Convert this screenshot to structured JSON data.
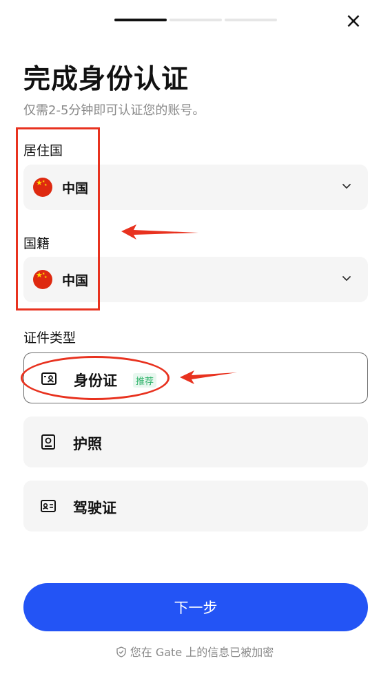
{
  "header": {
    "progress": {
      "steps_total": 3,
      "current_step": 1
    },
    "close_glyph": "×"
  },
  "title": "完成身份认证",
  "subtitle": "仅需2-5分钟即可认证您的账号。",
  "residence": {
    "label": "居住国",
    "value": "中国",
    "flag": "china-flag"
  },
  "nationality": {
    "label": "国籍",
    "value": "中国",
    "flag": "china-flag"
  },
  "document_type": {
    "label": "证件类型",
    "options": [
      {
        "label": "身份证",
        "badge": "推荐",
        "icon": "id-card-icon",
        "selected": true
      },
      {
        "label": "护照",
        "icon": "passport-icon",
        "selected": false
      },
      {
        "label": "驾驶证",
        "icon": "drivers-license-icon",
        "selected": false
      }
    ]
  },
  "next_button": "下一步",
  "footer": "您在 Gate 上的信息已被加密",
  "colors": {
    "primary": "#2354f5",
    "badge_green": "#2fb36a",
    "annotation_red": "#e8321f",
    "field_bg": "#f5f5f5"
  }
}
